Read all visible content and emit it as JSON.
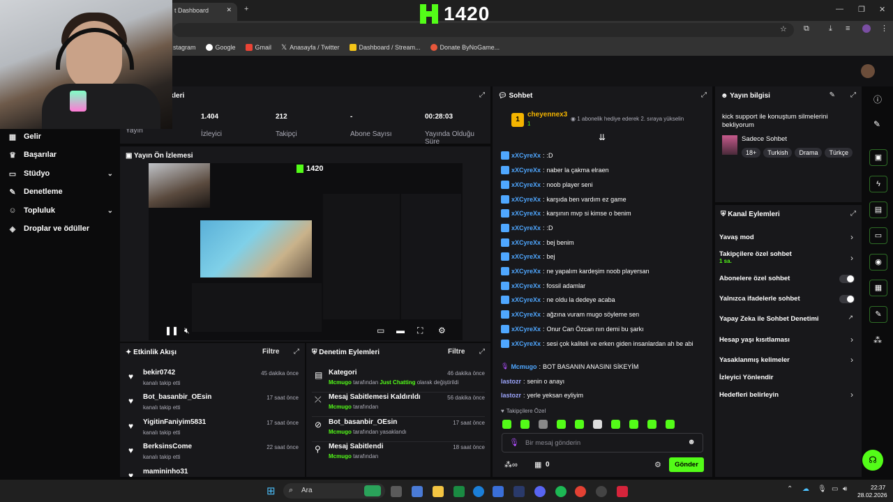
{
  "browser": {
    "tab_title": "t Dashboard",
    "bookmarks": [
      "stagram",
      "Google",
      "Gmail",
      "Anasayfa / Twitter",
      "Dashboard / Stream...",
      "Donate ByNoGame..."
    ]
  },
  "logo": {
    "text": "1420"
  },
  "nav": {
    "items": [
      {
        "label": "Gelir",
        "icon": "chart-icon"
      },
      {
        "label": "Başarılar",
        "icon": "trophy-icon"
      },
      {
        "label": "Stüdyo",
        "icon": "studio-icon",
        "expand": true
      },
      {
        "label": "Denetleme",
        "icon": "wrench-icon"
      },
      {
        "label": "Topluluk",
        "icon": "people-icon",
        "expand": true
      },
      {
        "label": "Droplar ve ödüller",
        "icon": "gift-icon"
      }
    ]
  },
  "stats": {
    "title": "stikleri",
    "items": [
      {
        "value": "",
        "label": "Yayın"
      },
      {
        "value": "1.404",
        "label": "İzleyici"
      },
      {
        "value": "212",
        "label": "Takipçi"
      },
      {
        "value": "-",
        "label": "Abone Sayısı"
      },
      {
        "value": "00:28:03",
        "label": "Yayında Olduğu Süre"
      }
    ]
  },
  "preview": {
    "title": "Yayın Ön İzlemesi",
    "inner_logo": "1420"
  },
  "events": {
    "title": "Etkinlik Akışı",
    "filter": "Filtre",
    "items": [
      {
        "name": "bekir0742",
        "sub": "kanalı takip etti",
        "time": "45 dakika önce"
      },
      {
        "name": "Bot_basanbir_OEsin",
        "sub": "kanalı takip etti",
        "time": "17 saat önce"
      },
      {
        "name": "YigitinFaniyim5831",
        "sub": "kanalı takip etti",
        "time": "17 saat önce"
      },
      {
        "name": "BerksinsCome",
        "sub": "kanalı takip etti",
        "time": "22 saat önce"
      },
      {
        "name": "mamininho31",
        "sub": "",
        "time": ""
      }
    ]
  },
  "mod": {
    "title": "Denetim Eylemleri",
    "filter": "Filtre",
    "items": [
      {
        "name": "Kategori",
        "actor": "Mcmugo",
        "mid": " tarafından ",
        "hl": "Just Chatting",
        "tail": " olarak değiştirildi",
        "time": "46 dakika önce",
        "icon": "category-icon"
      },
      {
        "name": "Mesaj Sabitlemesi Kaldırıldı",
        "actor": "Mcmugo",
        "mid": " tarafından",
        "hl": "",
        "tail": "",
        "time": "56 dakika önce",
        "icon": "unpin-icon"
      },
      {
        "name": "Bot_basanbir_OEsin",
        "actor": "Mcmugo",
        "mid": " tarafından yasaklandı",
        "hl": "",
        "tail": "",
        "time": "17 saat önce",
        "icon": "ban-icon"
      },
      {
        "name": "Mesaj Sabitlendi",
        "actor": "Mcmugo",
        "mid": " tarafından",
        "hl": "",
        "tail": "",
        "time": "18 saat önce",
        "icon": "pin-icon"
      }
    ]
  },
  "chat": {
    "title": "Sohbet",
    "gift_user": "cheyennex3",
    "gift_count": "1",
    "gift_text": "1 abonelik hediye ederek 2. sıraya yükselin",
    "messages": [
      {
        "user": "xXCyreXx",
        "text": ":D"
      },
      {
        "user": "xXCyreXx",
        "text": "naber la çakma elraen"
      },
      {
        "user": "xXCyreXx",
        "text": "noob player seni"
      },
      {
        "user": "xXCyreXx",
        "text": "karşıda ben vardım ez game"
      },
      {
        "user": "xXCyreXx",
        "text": "karşının mvp si kimse o benim"
      },
      {
        "user": "xXCyreXx",
        "text": ":D"
      },
      {
        "user": "xXCyreXx",
        "text": "bej benim"
      },
      {
        "user": "xXCyreXx",
        "text": "bej"
      },
      {
        "user": "xXCyreXx",
        "text": "ne yapalım kardeşim noob playersan"
      },
      {
        "user": "xXCyreXx",
        "text": "fossil adamlar"
      },
      {
        "user": "xXCyreXx",
        "text": "ne oldu la dedeye acaba"
      },
      {
        "user": "xXCyreXx",
        "text": "ağzına vuram mugo söyleme sen"
      },
      {
        "user": "xXCyreXx",
        "text": "Onur Can Özcan nın demi bu şarkı"
      },
      {
        "user": "xXCyreXx",
        "text": "sesi çok kaliteli ve erken giden insanlardan ah be abi"
      }
    ],
    "msg_mcmugo": {
      "user": "Mcmugo",
      "text": "BOT BASANIN ANASINI SİKEYİM"
    },
    "msg_l1": {
      "user": "lastozr",
      "text": "senin o anayı"
    },
    "msg_l2": {
      "user": "lastozr",
      "text": "yerle yeksan eyliyim"
    },
    "followers_only": "Takipçilere Özel",
    "input_placeholder": "Bir mesaj gönderin",
    "points": "0",
    "send": "Gönder"
  },
  "info": {
    "title": "Yayın bilgisi",
    "stream_title": "kick support ile konuştum silmelerini bekliyorum",
    "category": "Sadece Sohbet",
    "tags": [
      "18+",
      "Turkish",
      "Drama",
      "Türkçe"
    ]
  },
  "channel": {
    "title": "Kanal Eylemleri",
    "items": [
      {
        "label": "Yavaş mod",
        "kind": "chev"
      },
      {
        "label": "Takipçilere özel sohbet",
        "kind": "chev",
        "sub": "1 sa."
      },
      {
        "label": "Abonelere özel sohbet",
        "kind": "toggle"
      },
      {
        "label": "Yalnızca ifadelerle sohbet",
        "kind": "toggle"
      },
      {
        "label": "Yapay Zeka ile Sohbet Denetimi",
        "kind": "ext"
      },
      {
        "label": "Hesap yaşı kısıtlaması",
        "kind": "chev"
      },
      {
        "label": "Yasaklanmış kelimeler",
        "kind": "chev"
      },
      {
        "label": "İzleyici Yönlendir",
        "kind": "none"
      },
      {
        "label": "Hedefleri belirleyin",
        "kind": "chev"
      }
    ]
  },
  "taskbar": {
    "search": "Ara",
    "time": "22:37",
    "date": "28.02.2026"
  },
  "colors": {
    "accent": "#53fc18",
    "chat_user": "#4fa7ff",
    "panel": "#18181b"
  }
}
